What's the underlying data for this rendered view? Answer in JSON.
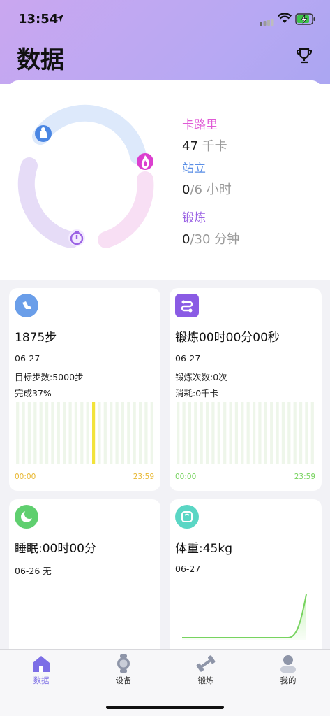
{
  "status_bar": {
    "time": "13:54"
  },
  "header": {
    "title": "数据"
  },
  "summary": {
    "calories": {
      "label": "卡路里",
      "value": "47",
      "unit": " 千卡",
      "color": "#e05ad6"
    },
    "stand": {
      "label": "站立",
      "value": "0",
      "goal": "/6 小时",
      "color": "#5b8fe6"
    },
    "exercise": {
      "label": "锻炼",
      "value": "0",
      "goal": "/30 分钟",
      "color": "#9b63e4"
    }
  },
  "steps_card": {
    "title": "1875步",
    "date": "06-27",
    "target": "目标步数:5000步",
    "complete": "完成37%",
    "axis_start": "00:00",
    "axis_end": "23:59",
    "accent": "#e8b730"
  },
  "workout_card": {
    "title": "锻炼00时00分00秒",
    "date": "06-27",
    "count": "锻炼次数:0次",
    "burn": "消耗:0千卡",
    "axis_start": "00:00",
    "axis_end": "23:59",
    "accent": "#77d35f"
  },
  "sleep_card": {
    "title": "睡眠:00时00分",
    "info": "06-26 无"
  },
  "weight_card": {
    "title": "体重:45kg",
    "date": "06-27"
  },
  "tabs": [
    {
      "label": "数据",
      "icon": "home-icon",
      "active": true
    },
    {
      "label": "设备",
      "icon": "watch-icon",
      "active": false
    },
    {
      "label": "锻炼",
      "icon": "dumbbell-icon",
      "active": false
    },
    {
      "label": "我的",
      "icon": "profile-icon",
      "active": false
    }
  ],
  "colors": {
    "active_tab": "#7c6ee6",
    "inactive_tab": "#8e95a8"
  }
}
